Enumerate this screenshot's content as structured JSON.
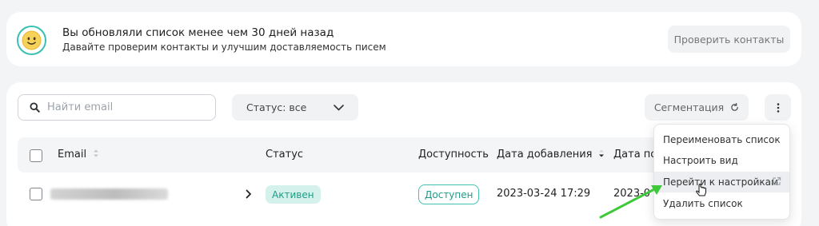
{
  "notice": {
    "title": "Вы обновляли список менее чем 30 дней назад",
    "subtitle": "Давайте проверим контакты и улучшим доставляемость писем",
    "check_button": "Проверить контакты"
  },
  "toolbar": {
    "search_placeholder": "Найти email",
    "status_filter": "Статус: все",
    "segmentation_button": "Сегментация"
  },
  "table": {
    "columns": {
      "email": "Email",
      "status": "Статус",
      "availability": "Доступность",
      "date_added": "Дата добавления",
      "date_next": "Дата по"
    },
    "rows": [
      {
        "status": "Активен",
        "availability": "Доступен",
        "date_added": "2023-03-24 17:29",
        "date_next": "2023-0"
      }
    ]
  },
  "menu": {
    "items": [
      {
        "label": "Переименовать список"
      },
      {
        "label": "Настроить вид"
      },
      {
        "label": "Перейти к настройкам"
      },
      {
        "label": "Удалить список"
      }
    ]
  },
  "colors": {
    "accent": "#38c1b0",
    "arrow": "#3fc93a"
  },
  "icons": [
    "smiley-icon",
    "search-icon",
    "chevron-down-icon",
    "refresh-icon",
    "kebab-menu-icon",
    "sort-icon",
    "sort-desc-icon",
    "chevron-right-icon",
    "external-link-icon",
    "hand-cursor-icon",
    "pointer-arrow"
  ]
}
